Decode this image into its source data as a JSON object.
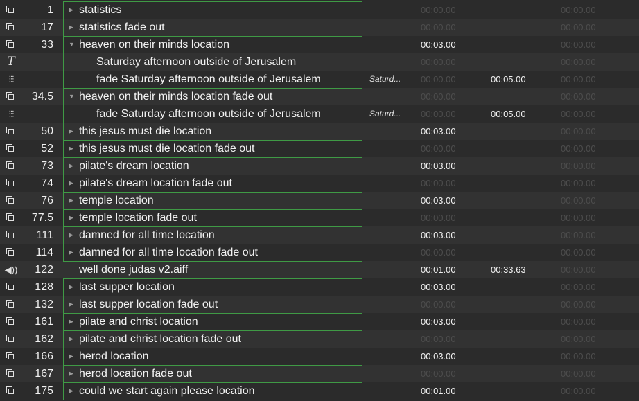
{
  "cues": [
    {
      "type": "group",
      "number": "1",
      "name": "statistics",
      "disclosure": "▶",
      "child": false,
      "target": "",
      "pre": "00:00.00",
      "pre_active": false,
      "action": "",
      "post": "00:00.00"
    },
    {
      "type": "group",
      "number": "17",
      "name": "statistics fade out",
      "disclosure": "▶",
      "child": false,
      "target": "",
      "pre": "00:00.00",
      "pre_active": false,
      "action": "",
      "post": "00:00.00"
    },
    {
      "type": "group",
      "number": "33",
      "name": "heaven on their minds location",
      "disclosure": "▼",
      "child": false,
      "target": "",
      "pre": "00:03.00",
      "pre_active": true,
      "action": "",
      "post": "00:00.00"
    },
    {
      "type": "text",
      "number": "",
      "name": "Saturday afternoon outside of Jerusalem",
      "disclosure": "",
      "child": true,
      "target": "",
      "pre": "00:00.00",
      "pre_active": false,
      "action": "",
      "post": "00:00.00"
    },
    {
      "type": "fade",
      "number": "",
      "name": "fade Saturday afternoon outside of Jerusalem",
      "disclosure": "",
      "child": true,
      "target": "Saturd...",
      "pre": "00:00.00",
      "pre_active": false,
      "action": "00:05.00",
      "post": "00:00.00"
    },
    {
      "type": "group",
      "number": "34.5",
      "name": "heaven on their minds location fade out",
      "disclosure": "▼",
      "child": false,
      "target": "",
      "pre": "00:00.00",
      "pre_active": false,
      "action": "",
      "post": "00:00.00"
    },
    {
      "type": "fade",
      "number": "",
      "name": "fade Saturday afternoon outside of Jerusalem",
      "disclosure": "",
      "child": true,
      "target": "Saturd...",
      "pre": "00:00.00",
      "pre_active": false,
      "action": "00:05.00",
      "post": "00:00.00"
    },
    {
      "type": "group",
      "number": "50",
      "name": "this jesus must die location",
      "disclosure": "▶",
      "child": false,
      "target": "",
      "pre": "00:03.00",
      "pre_active": true,
      "action": "",
      "post": "00:00.00"
    },
    {
      "type": "group",
      "number": "52",
      "name": "this jesus must die location fade out",
      "disclosure": "▶",
      "child": false,
      "target": "",
      "pre": "00:00.00",
      "pre_active": false,
      "action": "",
      "post": "00:00.00"
    },
    {
      "type": "group",
      "number": "73",
      "name": "pilate's dream location",
      "disclosure": "▶",
      "child": false,
      "target": "",
      "pre": "00:03.00",
      "pre_active": true,
      "action": "",
      "post": "00:00.00"
    },
    {
      "type": "group",
      "number": "74",
      "name": "pilate's dream location fade out",
      "disclosure": "▶",
      "child": false,
      "target": "",
      "pre": "00:00.00",
      "pre_active": false,
      "action": "",
      "post": "00:00.00"
    },
    {
      "type": "group",
      "number": "76",
      "name": "temple location",
      "disclosure": "▶",
      "child": false,
      "target": "",
      "pre": "00:03.00",
      "pre_active": true,
      "action": "",
      "post": "00:00.00"
    },
    {
      "type": "group",
      "number": "77.5",
      "name": "temple location fade out",
      "disclosure": "▶",
      "child": false,
      "target": "",
      "pre": "00:00.00",
      "pre_active": false,
      "action": "",
      "post": "00:00.00"
    },
    {
      "type": "group",
      "number": "111",
      "name": "damned for all time location",
      "disclosure": "▶",
      "child": false,
      "target": "",
      "pre": "00:03.00",
      "pre_active": true,
      "action": "",
      "post": "00:00.00"
    },
    {
      "type": "group",
      "number": "114",
      "name": "damned for all time location fade out",
      "disclosure": "▶",
      "child": false,
      "target": "",
      "pre": "00:00.00",
      "pre_active": false,
      "action": "",
      "post": "00:00.00"
    },
    {
      "type": "audio",
      "number": "122",
      "name": "well done judas v2.aiff",
      "disclosure": "",
      "child": false,
      "target": "",
      "pre": "00:01.00",
      "pre_active": true,
      "action": "00:33.63",
      "post": "00:00.00"
    },
    {
      "type": "group",
      "number": "128",
      "name": "last supper location",
      "disclosure": "▶",
      "child": false,
      "target": "",
      "pre": "00:03.00",
      "pre_active": true,
      "action": "",
      "post": "00:00.00"
    },
    {
      "type": "group",
      "number": "132",
      "name": "last supper location fade out",
      "disclosure": "▶",
      "child": false,
      "target": "",
      "pre": "00:00.00",
      "pre_active": false,
      "action": "",
      "post": "00:00.00"
    },
    {
      "type": "group",
      "number": "161",
      "name": "pilate and christ location",
      "disclosure": "▶",
      "child": false,
      "target": "",
      "pre": "00:03.00",
      "pre_active": true,
      "action": "",
      "post": "00:00.00"
    },
    {
      "type": "group",
      "number": "162",
      "name": "pilate and christ location fade out",
      "disclosure": "▶",
      "child": false,
      "target": "",
      "pre": "00:00.00",
      "pre_active": false,
      "action": "",
      "post": "00:00.00"
    },
    {
      "type": "group",
      "number": "166",
      "name": "herod location",
      "disclosure": "▶",
      "child": false,
      "target": "",
      "pre": "00:03.00",
      "pre_active": true,
      "action": "",
      "post": "00:00.00"
    },
    {
      "type": "group",
      "number": "167",
      "name": "herod location fade out",
      "disclosure": "▶",
      "child": false,
      "target": "",
      "pre": "00:00.00",
      "pre_active": false,
      "action": "",
      "post": "00:00.00"
    },
    {
      "type": "group",
      "number": "175",
      "name": "could we start again please location",
      "disclosure": "▶",
      "child": false,
      "target": "",
      "pre": "00:01.00",
      "pre_active": true,
      "action": "",
      "post": "00:00.00"
    }
  ],
  "colors": {
    "group_border": "#3f9a45",
    "dim_time": "#4d4d4d",
    "bright_time": "#f0f0f0"
  }
}
